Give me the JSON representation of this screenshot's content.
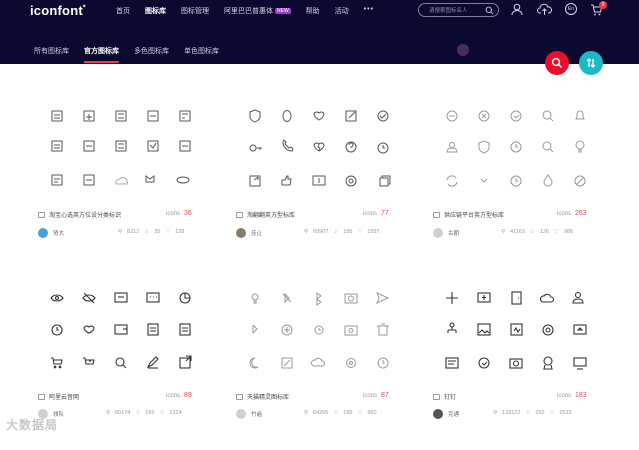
{
  "header": {
    "logo": "iconfont",
    "logo_mark": "*",
    "nav": [
      {
        "label": "首页",
        "active": false
      },
      {
        "label": "图标库",
        "active": true
      },
      {
        "label": "图标管理",
        "active": false
      },
      {
        "label": "阿里巴巴普惠体",
        "badge": "NEW",
        "active": false
      },
      {
        "label": "帮助",
        "active": false
      },
      {
        "label": "活动",
        "active": false
      },
      {
        "label": "•••",
        "active": false
      }
    ],
    "search_placeholder": "请搜索图标名人",
    "cart_count": "9",
    "lang_label": "En"
  },
  "tabs": [
    {
      "label": "所有图标库",
      "active": false
    },
    {
      "label": "官方图标库",
      "active": true
    },
    {
      "label": "多色图标库",
      "active": false
    },
    {
      "label": "单色图标库",
      "active": false
    }
  ],
  "colors": {
    "topbar": "#0b0930",
    "accent_red": "#e8102b",
    "accent_teal": "#1eb9c6",
    "count_red": "#e8455a"
  },
  "cards": [
    {
      "title": "淘宝心选英方位设分类标识",
      "icon_word": "icons",
      "count": "36",
      "author": "贤大",
      "stats": [
        "8212",
        "35",
        "128"
      ],
      "avatar": "#4a9fd8"
    },
    {
      "title": "淘翻翻英方型标库",
      "icon_word": "icons",
      "count": "77",
      "author": "佳让",
      "stats": [
        "69907",
        "195",
        "1597"
      ],
      "avatar": "#8a7a6a"
    },
    {
      "title": "供应链平台英方型标库",
      "icon_word": "icons",
      "count": "263",
      "author": "古朝",
      "stats": [
        "41163",
        "126",
        "986"
      ],
      "avatar": "#cfcfcf"
    },
    {
      "title": "阿里云音网",
      "icon_word": "icons",
      "count": "89",
      "author": "领队",
      "stats": [
        "80174",
        "169",
        "1324"
      ],
      "avatar": "#d0d0d0"
    },
    {
      "title": "天猫精灵图标库",
      "icon_word": "icons",
      "count": "87",
      "author": "竹遍",
      "stats": [
        "64205",
        "165",
        "960"
      ],
      "avatar": "#d0d0d0"
    },
    {
      "title": "钉钉",
      "icon_word": "icons",
      "count": "183",
      "author": "克通",
      "stats": [
        "133122",
        "292",
        "2515"
      ],
      "avatar": "#555555"
    }
  ],
  "watermark": "大数据局"
}
